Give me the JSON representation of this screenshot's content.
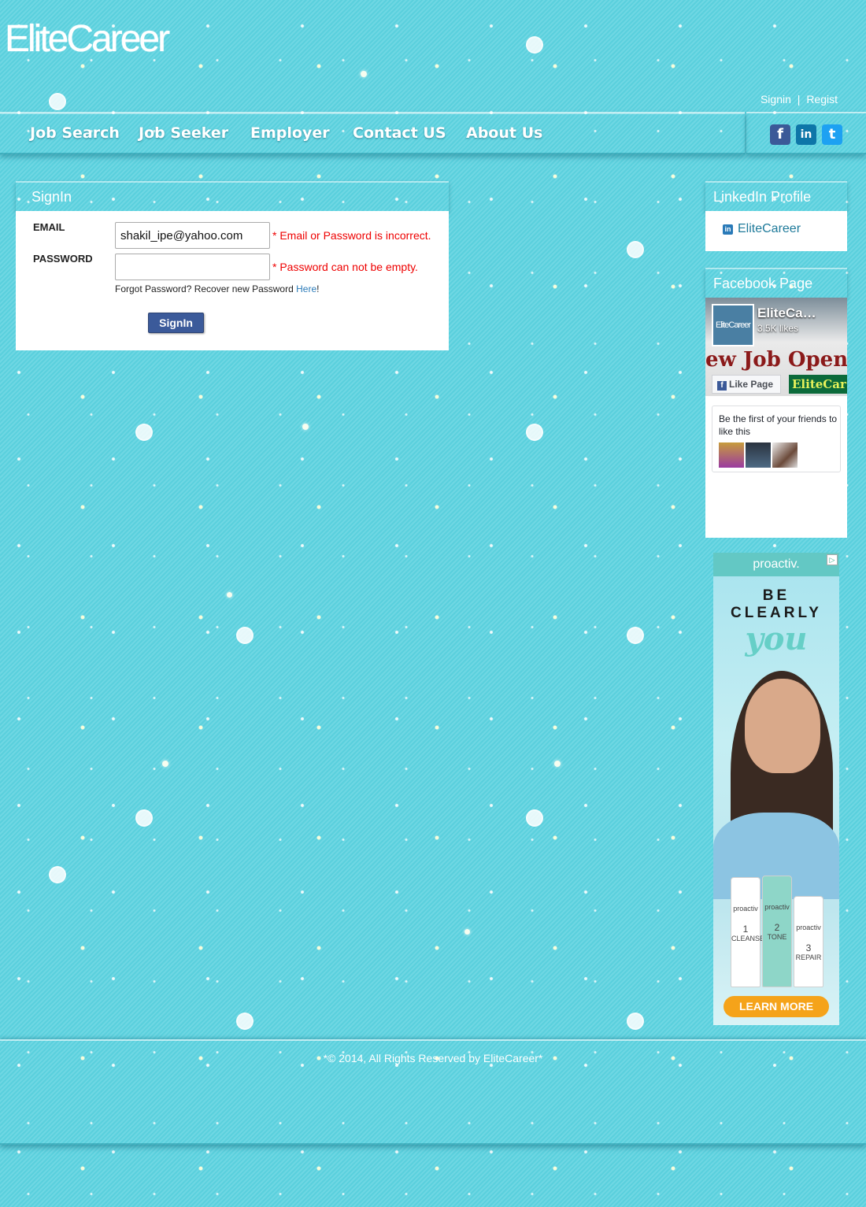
{
  "header": {
    "logo": "EliteCareer",
    "signin": "Signin",
    "separator": "|",
    "register": "Regist"
  },
  "nav": {
    "items": [
      "Job Search",
      "Job Seeker",
      "Employer",
      "Contact US",
      "About Us"
    ]
  },
  "social": {
    "facebook": "f",
    "linkedin": "in",
    "twitter": "t"
  },
  "signin_panel": {
    "title": "SignIn",
    "email_label": "EMAIL",
    "email_value": "shakil_ipe@yahoo.com",
    "email_error": "* Email or Password is incorrect.",
    "password_label": "PASSWORD",
    "password_value": "",
    "password_error": "* Password can not be empty.",
    "forgot_text": "Forgot Password? Recover new Password ",
    "forgot_link": "Here",
    "forgot_end": "!",
    "button": "SignIn"
  },
  "linkedin_panel": {
    "title": "LinkedIn Profile",
    "icon": "in",
    "link": "EliteCareer"
  },
  "facebook_panel": {
    "title": "Facebook Page",
    "thumb": "EliteCareer",
    "page_name": "EliteCa…",
    "likes": "3.5K likes",
    "banner": "ew Job Openin",
    "like_button": "Like Page",
    "tag": "EliteCar",
    "first_friends": "Be the first of your friends to like this"
  },
  "ad": {
    "brand": "proactiv.",
    "line1": "BE",
    "line2": "CLEARLY",
    "line3": "you",
    "bottles": [
      {
        "brand": "proactiv",
        "step": "1",
        "name": "CLEANSE"
      },
      {
        "brand": "proactiv",
        "step": "2",
        "name": "TONE"
      },
      {
        "brand": "proactiv",
        "step": "3",
        "name": "REPAIR"
      }
    ],
    "cta": "LEARN MORE",
    "choice": "▷"
  },
  "footer": {
    "text": "*© 2014, All Rights Reserved by EliteCareer*"
  },
  "colors": {
    "background": "#5fd3e0",
    "error": "#ee0000",
    "signin_button": "#3b5a9a",
    "link": "#1e7a9a",
    "ad_cta": "#f5a31a"
  }
}
